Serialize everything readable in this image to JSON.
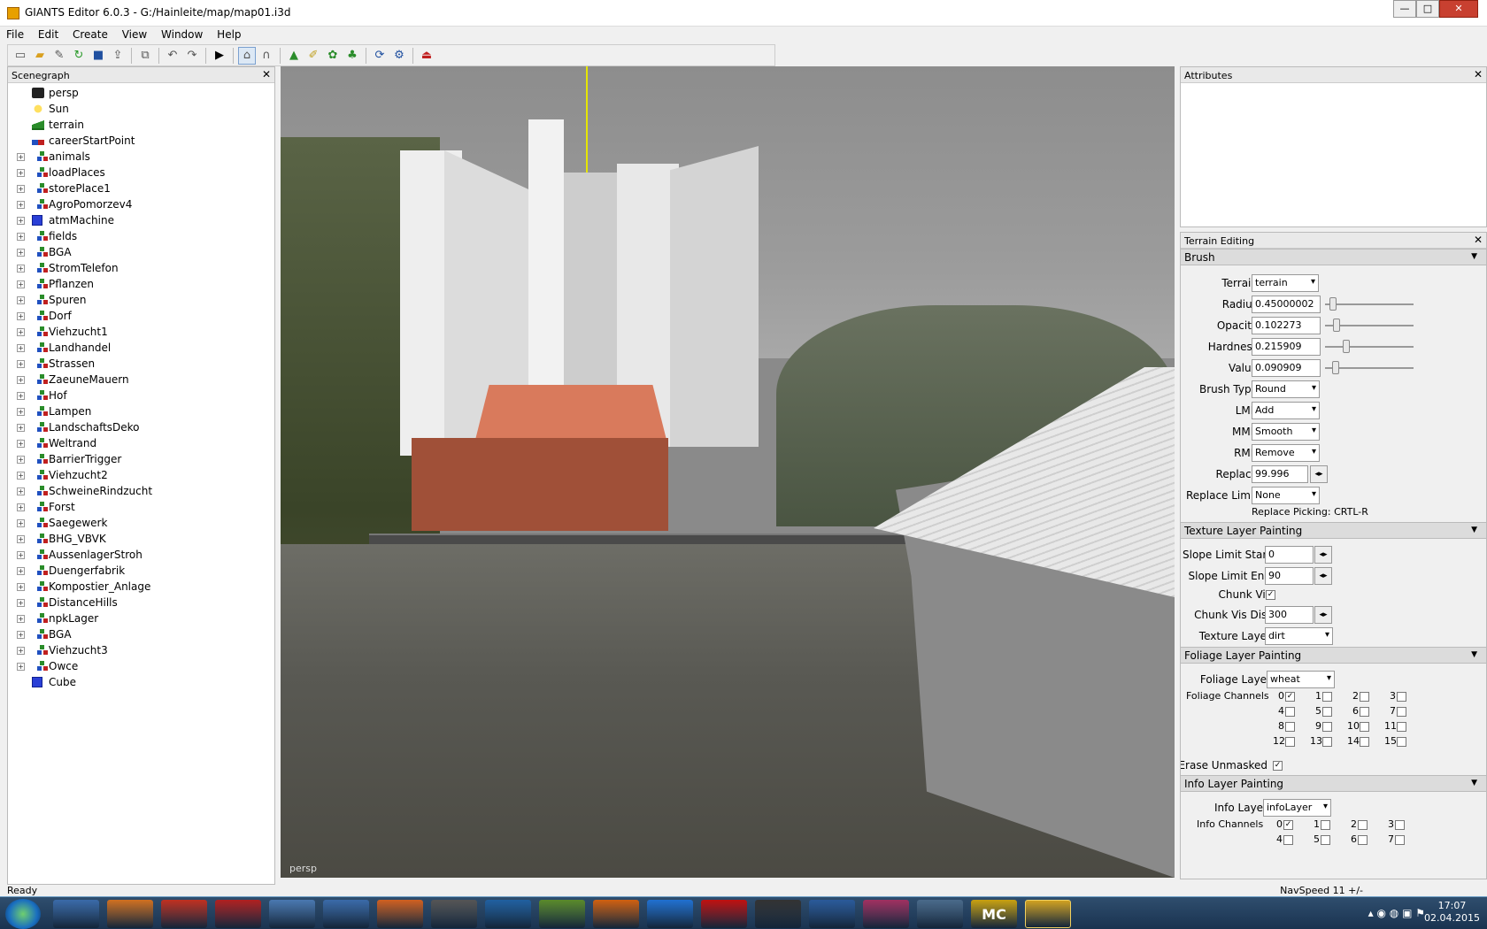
{
  "window": {
    "title": "GIANTS Editor 6.0.3 - G:/Hainleite/map/map01.i3d",
    "minimize": "—",
    "maximize": "□",
    "close": "✕"
  },
  "menu": [
    "File",
    "Edit",
    "Create",
    "View",
    "Window",
    "Help"
  ],
  "toolbar": {
    "icons": [
      "new-icon",
      "open-icon",
      "edit-icon",
      "refresh-icon",
      "save-icon",
      "export-icon",
      "import-icon",
      "undo-icon",
      "redo-icon",
      "play-icon",
      "select-icon",
      "move-icon",
      "terrain-sculpt-icon",
      "paint-icon",
      "foliage-icon",
      "tree-icon",
      "sync-icon",
      "settings-icon",
      "exit-icon"
    ]
  },
  "scenegraph": {
    "title": "Scenegraph",
    "close": "✕",
    "items": [
      {
        "label": "persp",
        "icon": "camera",
        "exp": false
      },
      {
        "label": "Sun",
        "icon": "sun",
        "exp": false
      },
      {
        "label": "terrain",
        "icon": "terrain",
        "exp": false
      },
      {
        "label": "careerStartPoint",
        "icon": "spawn",
        "exp": false
      },
      {
        "label": "animals",
        "icon": "tg",
        "exp": true
      },
      {
        "label": "loadPlaces",
        "icon": "tg",
        "exp": true
      },
      {
        "label": "storePlace1",
        "icon": "tg",
        "exp": true
      },
      {
        "label": "AgroPomorzev4",
        "icon": "tg",
        "exp": true
      },
      {
        "label": "atmMachine",
        "icon": "cube",
        "exp": true
      },
      {
        "label": "fields",
        "icon": "tg",
        "exp": true
      },
      {
        "label": "BGA",
        "icon": "tg",
        "exp": true
      },
      {
        "label": "StromTelefon",
        "icon": "tg",
        "exp": true
      },
      {
        "label": "Pflanzen",
        "icon": "tg",
        "exp": true
      },
      {
        "label": "Spuren",
        "icon": "tg",
        "exp": true
      },
      {
        "label": "Dorf",
        "icon": "tg",
        "exp": true
      },
      {
        "label": "Viehzucht1",
        "icon": "tg",
        "exp": true
      },
      {
        "label": "Landhandel",
        "icon": "tg",
        "exp": true
      },
      {
        "label": "Strassen",
        "icon": "tg",
        "exp": true
      },
      {
        "label": "ZaeuneMauern",
        "icon": "tg",
        "exp": true
      },
      {
        "label": "Hof",
        "icon": "tg",
        "exp": true
      },
      {
        "label": "Lampen",
        "icon": "tg",
        "exp": true
      },
      {
        "label": "LandschaftsDeko",
        "icon": "tg",
        "exp": true
      },
      {
        "label": "Weltrand",
        "icon": "tg",
        "exp": true
      },
      {
        "label": "BarrierTrigger",
        "icon": "tg",
        "exp": true
      },
      {
        "label": "Viehzucht2",
        "icon": "tg",
        "exp": true
      },
      {
        "label": "SchweineRindzucht",
        "icon": "tg",
        "exp": true
      },
      {
        "label": "Forst",
        "icon": "tg",
        "exp": true
      },
      {
        "label": "Saegewerk",
        "icon": "tg",
        "exp": true
      },
      {
        "label": "BHG_VBVK",
        "icon": "tg",
        "exp": true
      },
      {
        "label": "AussenlagerStroh",
        "icon": "tg",
        "exp": true
      },
      {
        "label": "Duengerfabrik",
        "icon": "tg",
        "exp": true
      },
      {
        "label": "Kompostier_Anlage",
        "icon": "tg",
        "exp": true
      },
      {
        "label": "DistanceHills",
        "icon": "tg",
        "exp": true
      },
      {
        "label": "npkLager",
        "icon": "tg",
        "exp": true
      },
      {
        "label": "BGA",
        "icon": "tg",
        "exp": true
      },
      {
        "label": "Viehzucht3",
        "icon": "tg",
        "exp": true
      },
      {
        "label": "Owce",
        "icon": "tg",
        "exp": true
      },
      {
        "label": "Cube",
        "icon": "cube",
        "exp": false
      }
    ]
  },
  "viewport": {
    "camera_label": "persp"
  },
  "attributes": {
    "title": "Attributes",
    "close": "✕"
  },
  "terrain_editing": {
    "title": "Terrain Editing",
    "close": "✕",
    "brush": {
      "title": "Brush",
      "terrain_label": "Terrain",
      "terrain_value": "terrain",
      "radius_label": "Radius",
      "radius_value": "0.45000002",
      "radius_frac": 0.05,
      "opacity_label": "Opacity",
      "opacity_value": "0.102273",
      "opacity_frac": 0.1,
      "hardness_label": "Hardness",
      "hardness_value": "0.215909",
      "hardness_frac": 0.22,
      "value_label": "Value",
      "value_value": "0.090909",
      "value_frac": 0.09,
      "brushtype_label": "Brush Type",
      "brushtype_value": "Round",
      "lmb_label": "LMB",
      "lmb_value": "Add",
      "mmb_label": "MMB",
      "mmb_value": "Smooth",
      "rmb_label": "RMB",
      "rmb_value": "Remove",
      "replace_label": "Replace",
      "replace_value": "99.996",
      "replacelimit_label": "Replace Limit",
      "replacelimit_value": "None",
      "picking_text": "Replace Picking: CRTL-R"
    },
    "texture": {
      "title": "Texture Layer Painting",
      "slopestart_label": "Slope Limit Start",
      "slopestart_value": "0",
      "slopeend_label": "Slope Limit End",
      "slopeend_value": "90",
      "chunkvis_label": "Chunk Vis",
      "chunkdist_label": "Chunk Vis Dist",
      "chunkdist_value": "300",
      "layer_label": "Texture Layer",
      "layer_value": "dirt"
    },
    "foliage": {
      "title": "Foliage Layer Painting",
      "layer_label": "Foliage Layer",
      "layer_value": "wheat",
      "channels_label": "Foliage Channels",
      "channels": [
        "0",
        "1",
        "2",
        "3",
        "4",
        "5",
        "6",
        "7",
        "8",
        "9",
        "10",
        "11",
        "12",
        "13",
        "14",
        "15"
      ],
      "erase_label": "Erase Unmasked"
    },
    "info": {
      "title": "Info Layer Painting",
      "layer_label": "Info Layer",
      "layer_value": "infoLayer",
      "channels_label": "Info Channels",
      "channels": [
        "0",
        "1",
        "2",
        "3",
        "4",
        "5",
        "6",
        "7"
      ]
    }
  },
  "status": {
    "left": "Ready",
    "right": "NavSpeed 11 +/-"
  },
  "taskbar": {
    "time": "17:07",
    "date": "02.04.2015",
    "apps": [
      "explorer",
      "media",
      "chrome",
      "kaspersky",
      "scanner",
      "ftp",
      "pdf",
      "chess",
      "mail",
      "notepad",
      "firefox",
      "thunder",
      "devil",
      "tractor",
      "teamviewer",
      "paint",
      "globe",
      "MC",
      "giants"
    ]
  }
}
